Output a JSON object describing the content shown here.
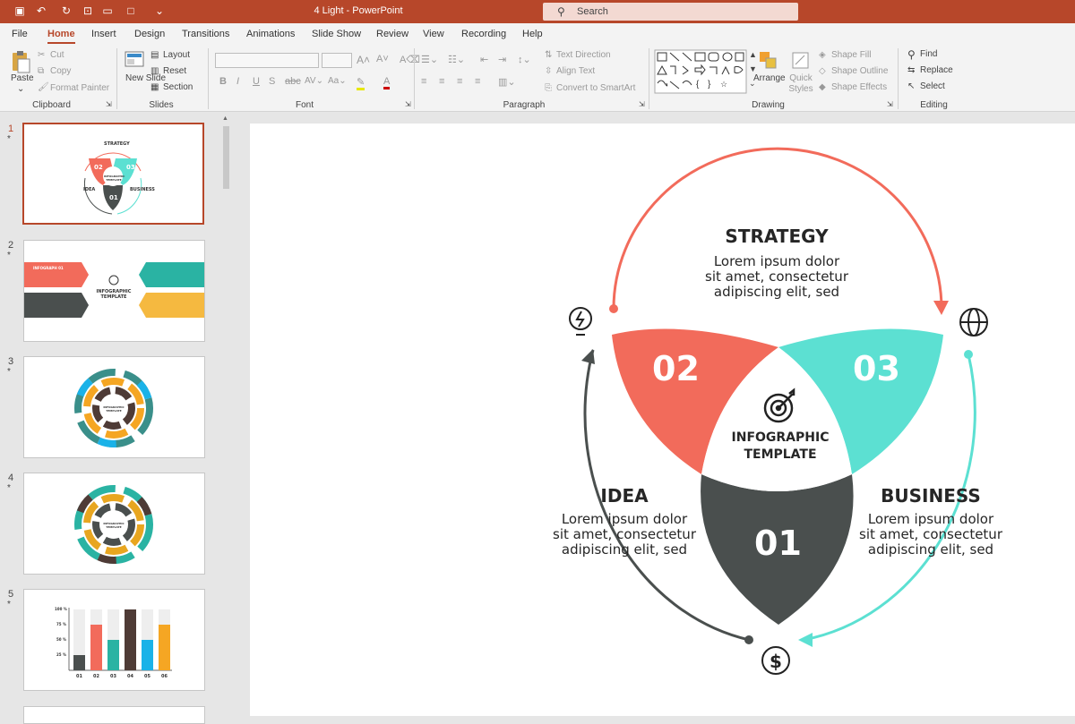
{
  "window": {
    "title": "4 Light  -  PowerPoint",
    "search_placeholder": "Search"
  },
  "menu": [
    "File",
    "Home",
    "Insert",
    "Design",
    "Transitions",
    "Animations",
    "Slide Show",
    "Review",
    "View",
    "Recording",
    "Help"
  ],
  "ribbon": {
    "clipboard": {
      "label": "Clipboard",
      "paste": "Paste",
      "cut": "Cut",
      "copy": "Copy",
      "format_painter": "Format Painter"
    },
    "slides": {
      "label": "Slides",
      "new_slide": "New Slide",
      "layout": "Layout",
      "reset": "Reset",
      "section": "Section"
    },
    "font": {
      "label": "Font"
    },
    "paragraph": {
      "label": "Paragraph",
      "text_direction": "Text Direction",
      "align_text": "Align Text",
      "smartart": "Convert to SmartArt"
    },
    "drawing": {
      "label": "Drawing",
      "arrange": "Arrange",
      "quick_styles": "Quick Styles",
      "shape_fill": "Shape Fill",
      "shape_outline": "Shape Outline",
      "shape_effects": "Shape Effects"
    },
    "editing": {
      "label": "Editing",
      "find": "Find",
      "replace": "Replace",
      "select": "Select"
    }
  },
  "thumbnails": [
    {
      "num": "1",
      "star": "*",
      "title": "STRATEGY",
      "t2": "IDEA",
      "t3": "BUSINESS",
      "n1": "02",
      "n2": "03",
      "n3": "01",
      "center": "INFOGRAPHIC TEMPLATE"
    },
    {
      "num": "2",
      "star": "*",
      "center": "INFOGRAPHIC TEMPLATE",
      "item": "INFOGRAPH 01"
    },
    {
      "num": "3",
      "star": "*",
      "center": "INFOGRAPHIC TEMPLATE"
    },
    {
      "num": "4",
      "star": "*",
      "center": "INFOGRAPHIC TEMPLATE"
    },
    {
      "num": "5",
      "star": "*",
      "y_ticks": [
        "100 %",
        "75 %",
        "50 %",
        "25 %"
      ],
      "x_labels": [
        "01",
        "02",
        "03",
        "04",
        "05",
        "06"
      ]
    }
  ],
  "chart_data": {
    "type": "bar",
    "categories": [
      "01",
      "02",
      "03",
      "04",
      "05",
      "06"
    ],
    "values": [
      25,
      75,
      50,
      100,
      50,
      75
    ],
    "ylim": [
      0,
      100
    ],
    "colors": [
      "#4a4f4e",
      "#f26b5b",
      "#2ab3a3",
      "#4e3b36",
      "#1ab2e8",
      "#f5a623"
    ]
  },
  "slide": {
    "strategy": {
      "title": "STRATEGY",
      "l1": "Lorem ipsum dolor",
      "l2": "sit amet, consectetur",
      "l3": "adipiscing elit, sed"
    },
    "idea": {
      "title": "IDEA",
      "l1": "Lorem ipsum dolor",
      "l2": "sit amet, consectetur",
      "l3": "adipiscing elit, sed"
    },
    "business": {
      "title": "BUSINESS",
      "l1": "Lorem ipsum dolor",
      "l2": "sit amet, consectetur",
      "l3": "adipiscing elit, sed"
    },
    "n02": "02",
    "n03": "03",
    "n01": "01",
    "center1": "INFOGRAPHIC",
    "center2": "TEMPLATE",
    "colors": {
      "coral": "#f26b5b",
      "teal": "#5ce0d2",
      "dark": "#4a4f4e"
    }
  }
}
